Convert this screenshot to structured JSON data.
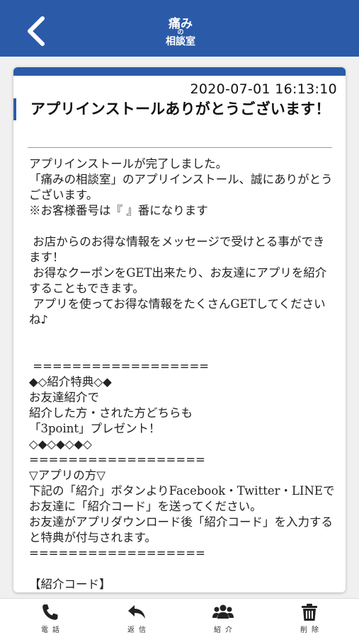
{
  "header": {
    "logo_line1": "痛み",
    "logo_line2": "の",
    "logo_line3": "相談室",
    "back_icon": "chevron-left-icon"
  },
  "message": {
    "date": "2020-07-01 16:13:10",
    "title": "アプリインストールありがとうございます！",
    "body": "アプリインストールが完了しました。\n「痛みの相談室」のアプリインストール、誠にありがとうございます。\n※お客様番号は『 』番になります\n\n お店からのお得な情報をメッセージで受けとる事ができます！\n お得なクーポンをGET出来たり、お友達にアプリを紹介することもできます。\n アプリを使ってお得な情報をたくさんGETしてくださいね♪\n\n\n ==================\n◆◇紹介特典◇◆\nお友達紹介で\n紹介した方・された方どちらも\n「3point」プレゼント！\n◇◆◇◆◇◆◇\n==================\n▽アプリの方▽\n下記の「紹介」ボタンよりFacebook・Twitter・LINEでお友達に「紹介コード」を送ってください。\nお友達がアプリダウンロード後「紹介コード」を入力すると特典が付与されます。\n==================\n\n【紹介コード】"
  },
  "footer": {
    "items": [
      {
        "label": "電話",
        "icon": "phone-icon"
      },
      {
        "label": "返信",
        "icon": "reply-icon"
      },
      {
        "label": "紹介",
        "icon": "users-icon"
      },
      {
        "label": "削除",
        "icon": "trash-icon"
      }
    ]
  },
  "colors": {
    "brand": "#2b5ba8",
    "background": "#f0f0f0",
    "card": "#ffffff"
  }
}
